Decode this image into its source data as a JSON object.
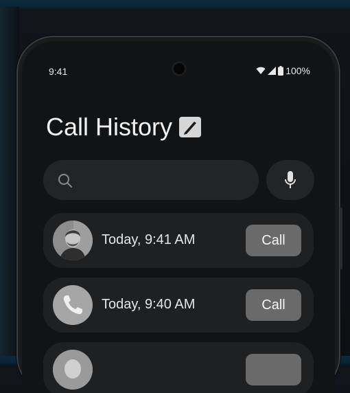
{
  "status_bar": {
    "time": "9:41",
    "battery": "100%",
    "icons": [
      "wifi-icon",
      "cellular-signal-icon",
      "battery-icon"
    ]
  },
  "header": {
    "title": "Call History",
    "edit_icon": "edit-pencil-icon"
  },
  "search": {
    "placeholder": "",
    "value": "",
    "search_icon": "search-icon",
    "mic_icon": "microphone-icon"
  },
  "calls": [
    {
      "time": "Today, 9:41 AM",
      "button_label": "Call",
      "avatar": "contact-photo"
    },
    {
      "time": "Today, 9:40 AM",
      "button_label": "Call",
      "avatar": "phone-icon"
    },
    {
      "time": "",
      "button_label": "",
      "avatar": "contact-photo"
    }
  ],
  "colors": {
    "background": "#0d0f12",
    "screen": "#121314",
    "row": "#1f2022",
    "button": "#6a6a6a",
    "text": "#f2f2f2"
  }
}
